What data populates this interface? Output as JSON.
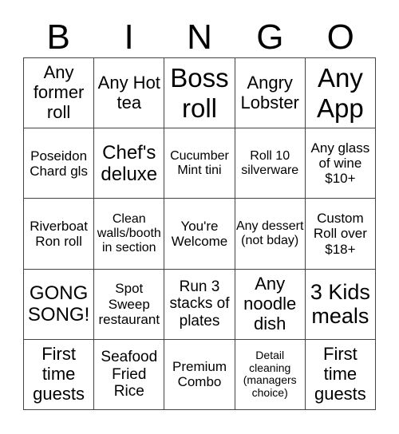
{
  "header": {
    "letters": [
      "B",
      "I",
      "N",
      "G",
      "O"
    ]
  },
  "cells": [
    "Any former roll",
    "Any Hot tea",
    "Boss roll",
    "Angry Lobster",
    "Any App",
    "Poseidon Chard gls",
    "Chef's deluxe",
    "Cucumber Mint tini",
    "Roll 10 silverware",
    "Any glass of wine $10+",
    "Riverboat Ron roll",
    "Clean walls/booth in section",
    "You're Welcome",
    "Any dessert (not bday)",
    "Custom Roll over $18+",
    "GONG SONG!",
    "Spot Sweep restaurant",
    "Run 3 stacks of plates",
    "Any noodle dish",
    "3 Kids meals",
    "First time guests",
    "Seafood Fried Rice",
    "Premium Combo",
    "Detail cleaning (managers choice)",
    "First time guests"
  ]
}
